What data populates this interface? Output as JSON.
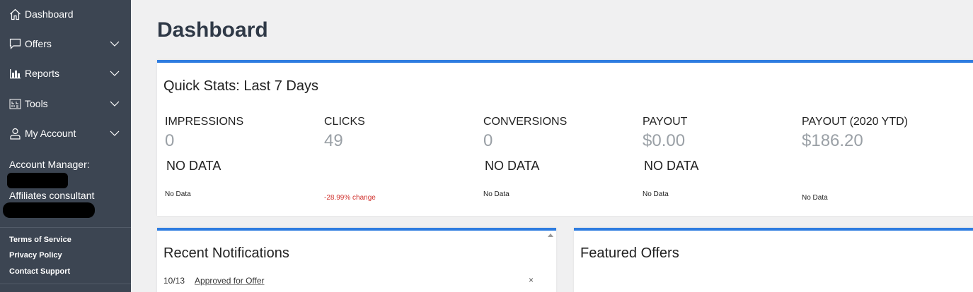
{
  "sidebar": {
    "items": [
      {
        "label": "Dashboard",
        "icon": "home-icon"
      },
      {
        "label": "Offers",
        "icon": "chat-icon"
      },
      {
        "label": "Reports",
        "icon": "bar-chart-icon"
      },
      {
        "label": "Tools",
        "icon": "tools-icon"
      },
      {
        "label": "My Account",
        "icon": "user-icon"
      }
    ],
    "account_manager_label": "Account Manager:",
    "consultant_label": "Affiliates consultant",
    "footer_links": [
      "Terms of Service",
      "Privacy Policy",
      "Contact Support"
    ]
  },
  "page": {
    "title": "Dashboard"
  },
  "quick_stats": {
    "title": "Quick Stats: Last 7 Days",
    "stats": [
      {
        "label": "IMPRESSIONS",
        "value": "0",
        "nodata": "NO DATA",
        "foot": "No Data"
      },
      {
        "label": "CLICKS",
        "value": "49",
        "nodata": "",
        "foot": "-28.99% change"
      },
      {
        "label": "CONVERSIONS",
        "value": "0",
        "nodata": "NO DATA",
        "foot": "No Data"
      },
      {
        "label": "PAYOUT",
        "value": "$0.00",
        "nodata": "NO DATA",
        "foot": "No Data"
      },
      {
        "label": "PAYOUT (2020 YTD)",
        "value": "$186.20",
        "nodata": "",
        "foot": "No Data"
      }
    ]
  },
  "notifications": {
    "title": "Recent Notifications",
    "items": [
      {
        "date": "10/13",
        "text": "Approved for Offer",
        "close": "×"
      }
    ]
  },
  "featured": {
    "title": "Featured Offers"
  },
  "colors": {
    "sidebar_bg": "#3c4552",
    "accent": "#2e7ce0",
    "negative": "#d0312d"
  }
}
